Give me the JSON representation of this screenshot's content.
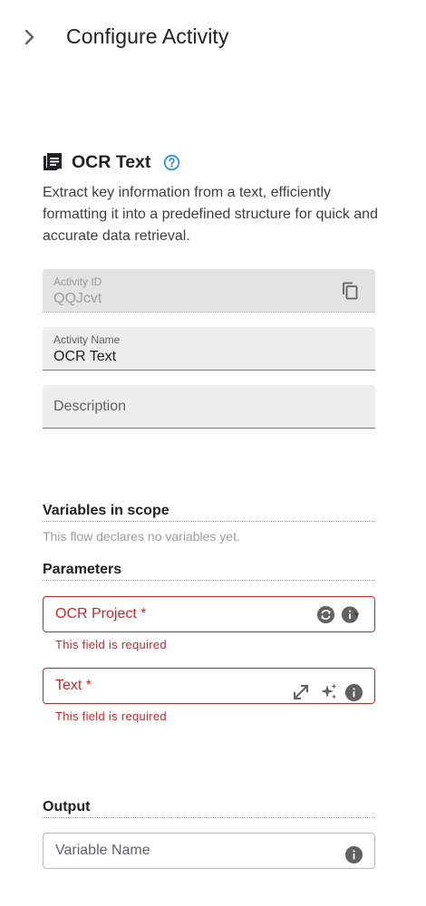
{
  "header": {
    "title": "Configure Activity"
  },
  "activity": {
    "name": "OCR Text",
    "description": "Extract key information from a text, efficiently formatting it into a predefined structure for quick and accurate data retrieval."
  },
  "fields": {
    "activity_id": {
      "label": "Activity ID",
      "value": "QQJcvt"
    },
    "activity_name": {
      "label": "Activity Name",
      "value": "OCR Text"
    },
    "description": {
      "placeholder": "Description"
    }
  },
  "variables": {
    "title": "Variables in scope",
    "empty_text": "This flow declares no variables yet."
  },
  "parameters": {
    "title": "Parameters",
    "ocr_project": {
      "placeholder": "OCR Project *",
      "error": "This field is required"
    },
    "text": {
      "placeholder": "Text *",
      "error": "This field is required"
    }
  },
  "output": {
    "title": "Output",
    "variable_name": {
      "placeholder": "Variable Name"
    }
  },
  "colors": {
    "error": "#c62828",
    "accent": "#1e88e5",
    "icon": "#616161"
  }
}
